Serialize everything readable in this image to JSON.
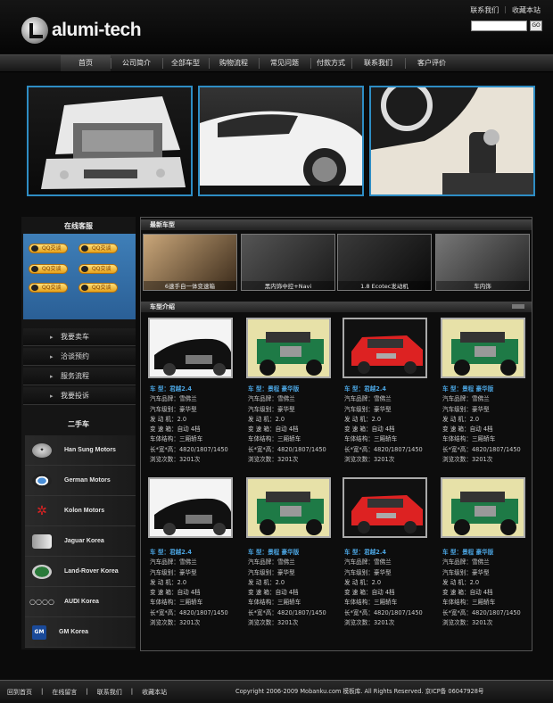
{
  "header": {
    "logo_text": "alumi-tech",
    "toplinks": [
      "联系我们",
      "收藏本站"
    ],
    "search_placeholder": "",
    "go_label": "GO"
  },
  "nav": [
    "首页",
    "公司简介",
    "全部车型",
    "购物流程",
    "常见问题",
    "付款方式",
    "联系我们",
    "客户评价"
  ],
  "left": {
    "service_title": "在线客服",
    "qq_label": "QQ交谈",
    "menu": [
      "我要卖车",
      "洽谈预约",
      "服务流程",
      "我要投诉"
    ],
    "used_title": "二手车",
    "brands": [
      {
        "name": "Han Sung Motors",
        "icon": "mercedes-logo-icon"
      },
      {
        "name": "German Motors",
        "icon": "bmw-logo-icon"
      },
      {
        "name": "Kolon Motors",
        "icon": "kolon-logo-icon"
      },
      {
        "name": "Jaguar Korea",
        "icon": "jaguar-logo-icon"
      },
      {
        "name": "Land-Rover Korea",
        "icon": "landrover-logo-icon"
      },
      {
        "name": "AUDI Korea",
        "icon": "audi-logo-icon"
      },
      {
        "name": "GM Korea",
        "icon": "gm-logo-icon"
      }
    ]
  },
  "newest": {
    "title": "最新车型",
    "items": [
      "6速手自一体变速箱",
      "黑内饰中控+Navi",
      "1.8 Ecotec发动机",
      "车内饰"
    ]
  },
  "intro": {
    "title": "车型介绍",
    "cars": [
      {
        "type": "车 型：君越2.4",
        "brand": "汽车品牌：雪佛兰",
        "grade": "汽车级别：豪华型",
        "engine": "发 动 机：2.0",
        "gearbox": "变 速 箱：自动 4档",
        "body": "车体结构：三厢轿车",
        "size": "长*宽*高：4820/1807/1450",
        "views": "浏览次数：3201次"
      },
      {
        "type": "车 型：景程 豪华版",
        "brand": "汽车品牌：雪佛兰",
        "grade": "汽车级别：豪华型",
        "engine": "发 动 机：2.0",
        "gearbox": "变 速 箱：自动 4档",
        "body": "车体结构：三厢轿车",
        "size": "长*宽*高：4820/1807/1450",
        "views": "浏览次数：3201次"
      },
      {
        "type": "车 型：君越2.4",
        "brand": "汽车品牌：雪佛兰",
        "grade": "汽车级别：豪华型",
        "engine": "发 动 机：2.0",
        "gearbox": "变 速 箱：自动 4档",
        "body": "车体结构：三厢轿车",
        "size": "长*宽*高：4820/1807/1450",
        "views": "浏览次数：3201次"
      },
      {
        "type": "车 型：景程 豪华版",
        "brand": "汽车品牌：雪佛兰",
        "grade": "汽车级别：豪华型",
        "engine": "发 动 机：2.0",
        "gearbox": "变 速 箱：自动 4档",
        "body": "车体结构：三厢轿车",
        "size": "长*宽*高：4820/1807/1450",
        "views": "浏览次数：3201次"
      },
      {
        "type": "车 型：君越2.4",
        "brand": "汽车品牌：雪佛兰",
        "grade": "汽车级别：豪华型",
        "engine": "发 动 机：2.0",
        "gearbox": "变 速 箱：自动 4档",
        "body": "车体结构：三厢轿车",
        "size": "长*宽*高：4820/1807/1450",
        "views": "浏览次数：3201次"
      },
      {
        "type": "车 型：景程 豪华版",
        "brand": "汽车品牌：雪佛兰",
        "grade": "汽车级别：豪华型",
        "engine": "发 动 机：2.0",
        "gearbox": "变 速 箱：自动 4档",
        "body": "车体结构：三厢轿车",
        "size": "长*宽*高：4820/1807/1450",
        "views": "浏览次数：3201次"
      },
      {
        "type": "车 型：君越2.4",
        "brand": "汽车品牌：雪佛兰",
        "grade": "汽车级别：豪华型",
        "engine": "发 动 机：2.0",
        "gearbox": "变 速 箱：自动 4档",
        "body": "车体结构：三厢轿车",
        "size": "长*宽*高：4820/1807/1450",
        "views": "浏览次数：3201次"
      },
      {
        "type": "车 型：景程 豪华版",
        "brand": "汽车品牌：雪佛兰",
        "grade": "汽车级别：豪华型",
        "engine": "发 动 机：2.0",
        "gearbox": "变 速 箱：自动 4档",
        "body": "车体结构：三厢轿车",
        "size": "长*宽*高：4820/1807/1450",
        "views": "浏览次数：3201次"
      }
    ]
  },
  "footer": {
    "links": [
      "回到首页",
      "在线留言",
      "联系我们",
      "收藏本站"
    ],
    "copyright": "Copyright 2006-2009 Mobanku.com 模板库. All Rights Reserved. 京ICP备 06047928号"
  },
  "colors": {
    "accent": "#2e8dc4",
    "title_blue": "#4aa3df",
    "background": "#0b0b0b"
  }
}
